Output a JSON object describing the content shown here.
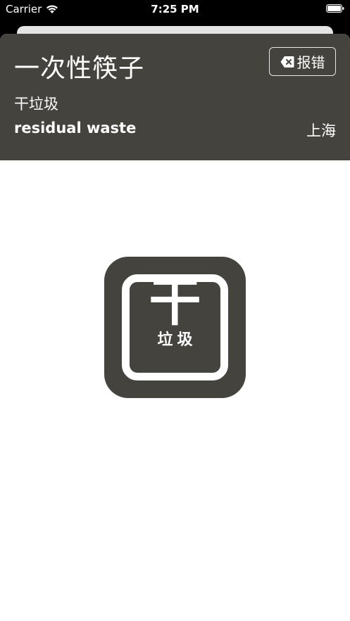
{
  "status_bar": {
    "carrier": "Carrier",
    "time": "7:25 PM"
  },
  "header": {
    "item_name": "一次性筷子",
    "report_label": "报错",
    "category_cn": "干垃圾",
    "category_en": "residual waste",
    "city": "上海"
  },
  "badge": {
    "glyph": "干",
    "label": "垃圾"
  },
  "colors": {
    "header_bg": "#45433e",
    "badge_bg": "#45433e",
    "sheet_bg": "#ffffff",
    "text_on_dark": "#ffffff"
  },
  "icons": {
    "wifi": "wifi-icon",
    "battery": "battery-icon",
    "report": "delete-x-icon"
  }
}
